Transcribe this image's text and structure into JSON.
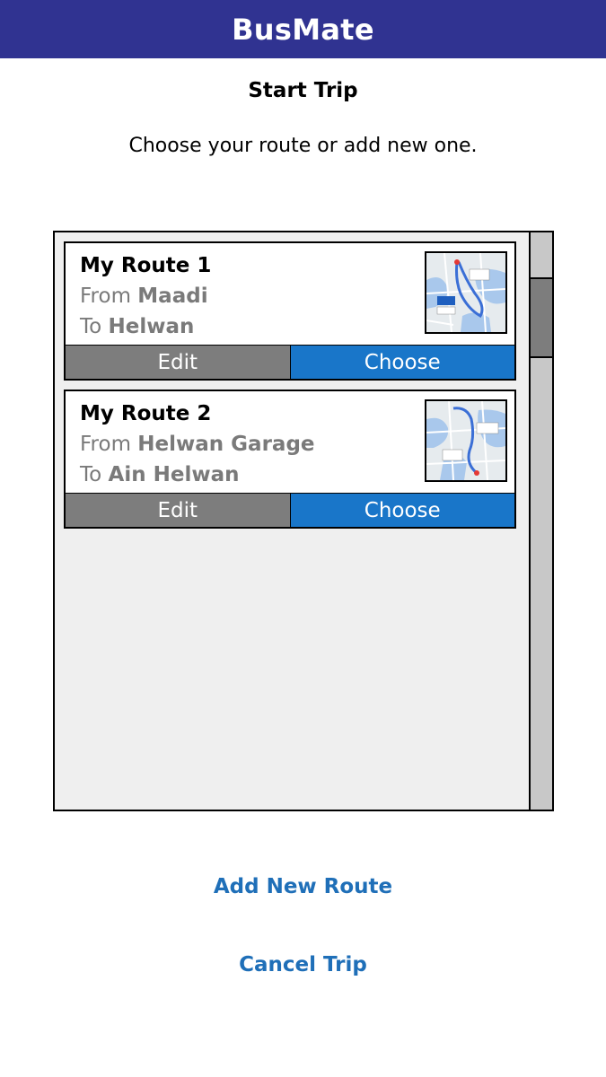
{
  "app": {
    "title": "BusMate"
  },
  "page": {
    "title": "Start Trip",
    "subtitle": "Choose your route or add new one."
  },
  "routes": [
    {
      "name": "My Route 1",
      "from_prefix": "From",
      "from": "Maadi",
      "to_prefix": "To",
      "to": "Helwan",
      "edit_label": "Edit",
      "choose_label": "Choose"
    },
    {
      "name": "My Route 2",
      "from_prefix": "From",
      "from": "Helwan Garage",
      "to_prefix": "To",
      "to": "Ain Helwan",
      "edit_label": "Edit",
      "choose_label": "Choose"
    }
  ],
  "actions": {
    "add_route": "Add New Route",
    "cancel_trip": "Cancel Trip"
  },
  "colors": {
    "header": "#303391",
    "choose_button": "#1976c9",
    "edit_button": "#7d7d7d",
    "link": "#1f6fb8"
  },
  "icons": {
    "map_thumbnail": "route-map-icon"
  }
}
